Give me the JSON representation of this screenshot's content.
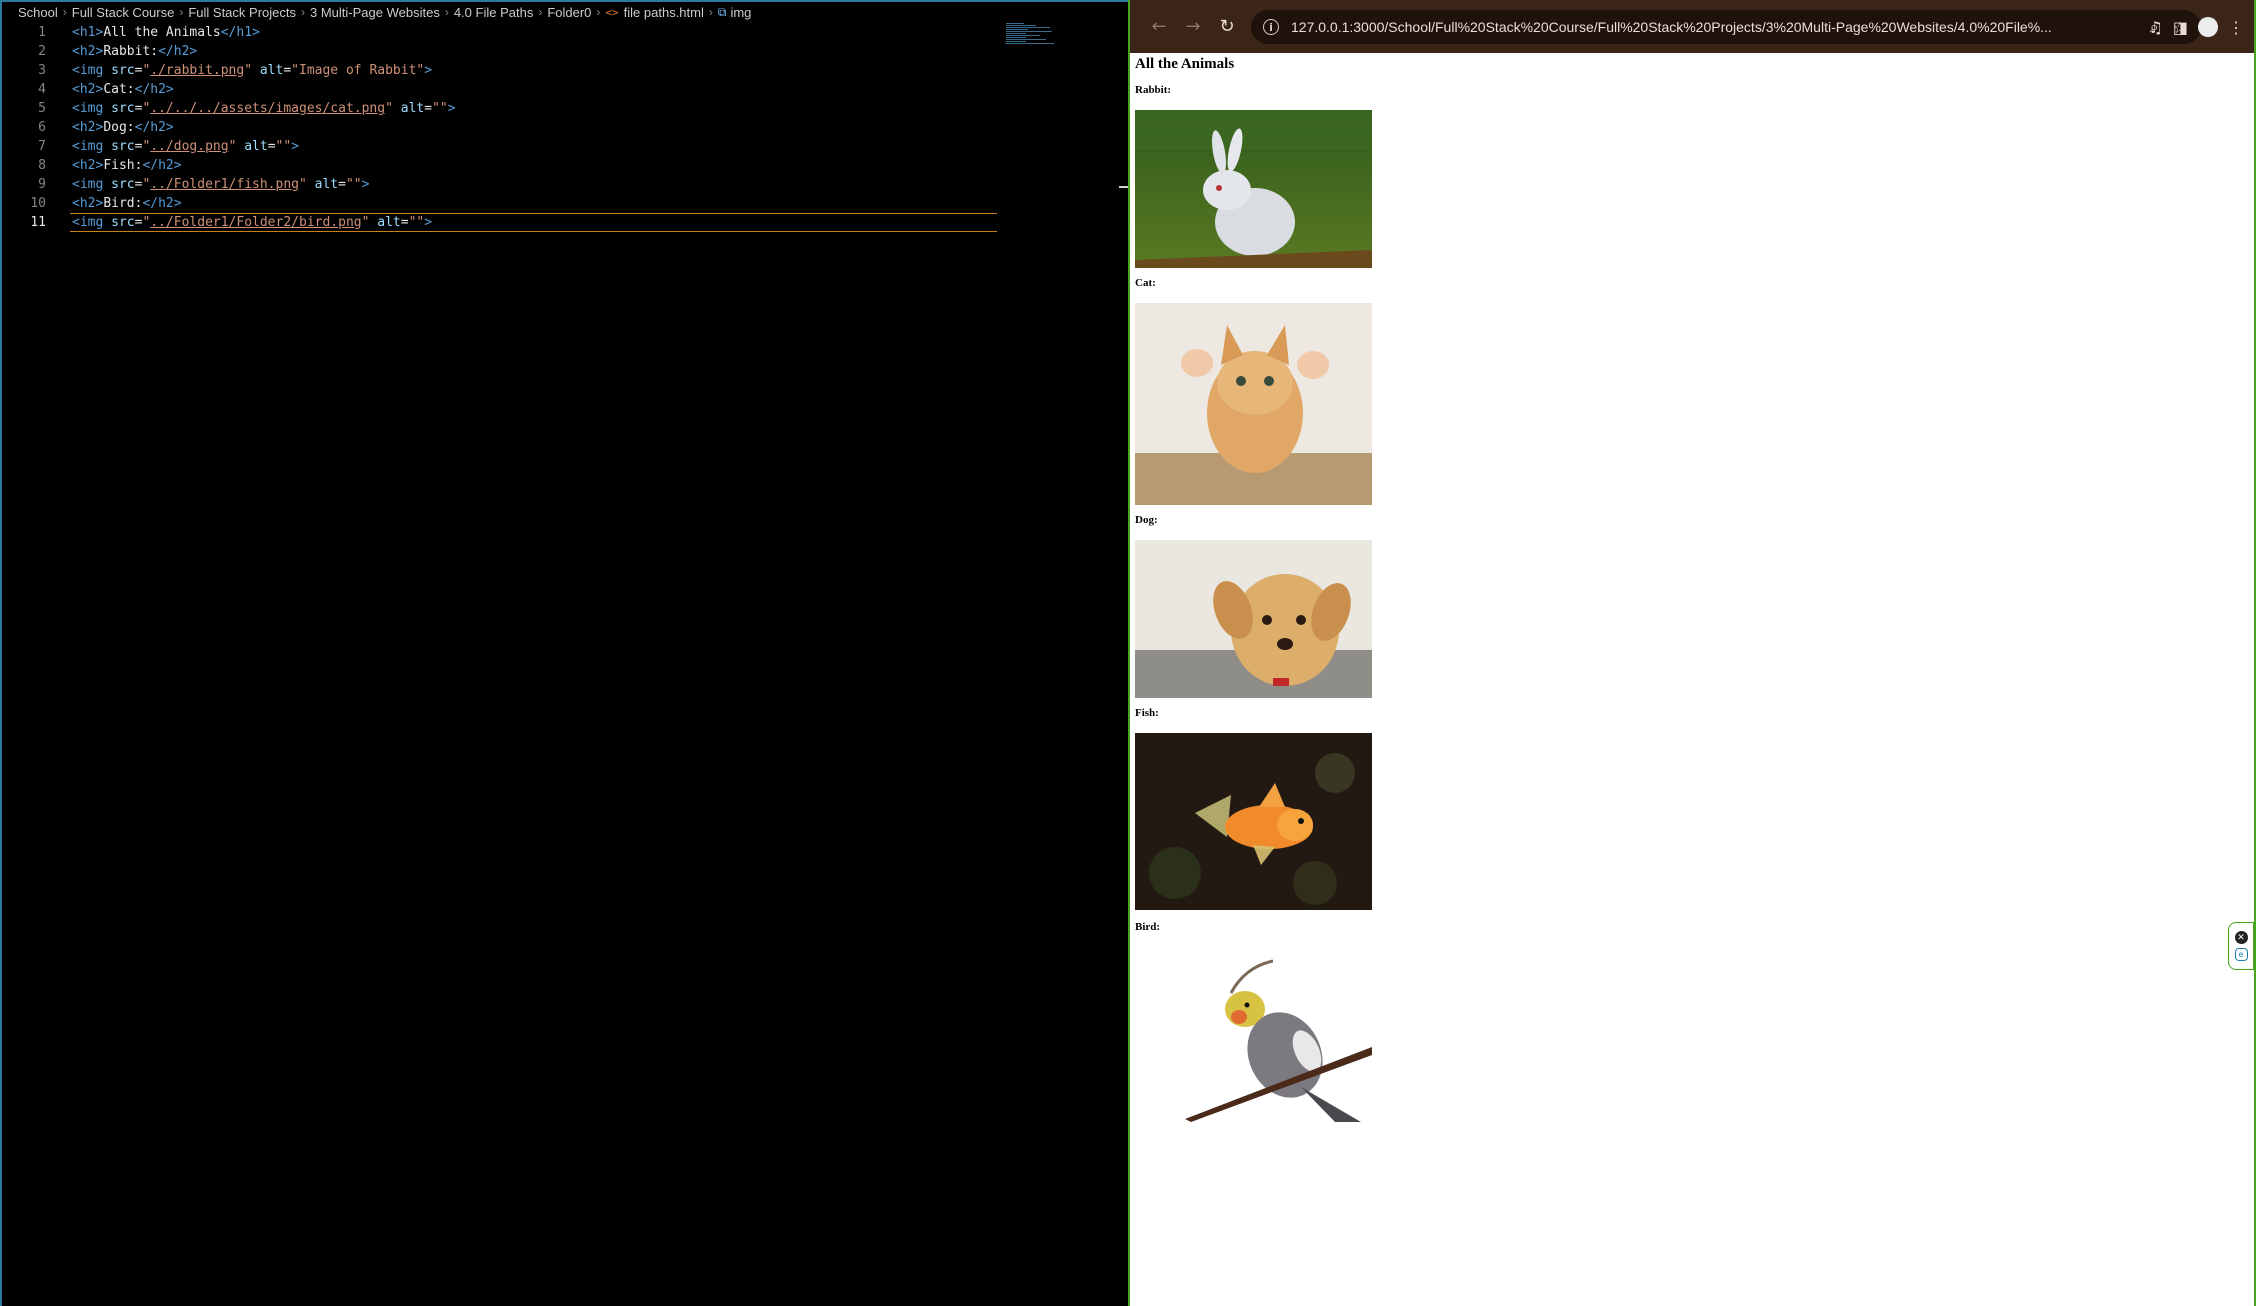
{
  "editor": {
    "breadcrumb": [
      "School",
      "Full Stack Course",
      "Full Stack Projects",
      "3 Multi-Page Websites",
      "4.0 File Paths",
      "Folder0",
      "file paths.html",
      "img"
    ],
    "active_line": 11,
    "lines": [
      {
        "num": "1",
        "parts": [
          [
            "t",
            "<h1>"
          ],
          [
            "tx",
            "All the Animals"
          ],
          [
            "t",
            "</h1>"
          ]
        ]
      },
      {
        "num": "2",
        "parts": [
          [
            "t",
            "<h2>"
          ],
          [
            "tx",
            "Rabbit:"
          ],
          [
            "t",
            "</h2>"
          ]
        ]
      },
      {
        "num": "3",
        "parts": [
          [
            "t",
            "<img "
          ],
          [
            "at",
            "src"
          ],
          [
            "tx",
            "="
          ],
          [
            "st",
            "\""
          ],
          [
            "stp",
            "./rabbit.png"
          ],
          [
            "st",
            "\""
          ],
          [
            "tx",
            " "
          ],
          [
            "at",
            "alt"
          ],
          [
            "tx",
            "="
          ],
          [
            "st",
            "\"Image of Rabbit\""
          ],
          [
            "t",
            ">"
          ]
        ]
      },
      {
        "num": "4",
        "parts": [
          [
            "t",
            "<h2>"
          ],
          [
            "tx",
            "Cat:"
          ],
          [
            "t",
            "</h2>"
          ]
        ]
      },
      {
        "num": "5",
        "parts": [
          [
            "t",
            "<img "
          ],
          [
            "at",
            "src"
          ],
          [
            "tx",
            "="
          ],
          [
            "st",
            "\""
          ],
          [
            "stp",
            "../../../assets/images/cat.png"
          ],
          [
            "st",
            "\""
          ],
          [
            "tx",
            " "
          ],
          [
            "at",
            "alt"
          ],
          [
            "tx",
            "="
          ],
          [
            "st",
            "\"\""
          ],
          [
            "t",
            ">"
          ]
        ]
      },
      {
        "num": "6",
        "parts": [
          [
            "t",
            "<h2>"
          ],
          [
            "tx",
            "Dog:"
          ],
          [
            "t",
            "</h2>"
          ]
        ]
      },
      {
        "num": "7",
        "parts": [
          [
            "t",
            "<img "
          ],
          [
            "at",
            "src"
          ],
          [
            "tx",
            "="
          ],
          [
            "st",
            "\""
          ],
          [
            "stp",
            "../dog.png"
          ],
          [
            "st",
            "\""
          ],
          [
            "tx",
            " "
          ],
          [
            "at",
            "alt"
          ],
          [
            "tx",
            "="
          ],
          [
            "st",
            "\"\""
          ],
          [
            "t",
            ">"
          ]
        ]
      },
      {
        "num": "8",
        "parts": [
          [
            "t",
            "<h2>"
          ],
          [
            "tx",
            "Fish:"
          ],
          [
            "t",
            "</h2>"
          ]
        ]
      },
      {
        "num": "9",
        "parts": [
          [
            "t",
            "<img "
          ],
          [
            "at",
            "src"
          ],
          [
            "tx",
            "="
          ],
          [
            "st",
            "\""
          ],
          [
            "stp",
            "../Folder1/fish.png"
          ],
          [
            "st",
            "\""
          ],
          [
            "tx",
            " "
          ],
          [
            "at",
            "alt"
          ],
          [
            "tx",
            "="
          ],
          [
            "st",
            "\"\""
          ],
          [
            "t",
            ">"
          ]
        ]
      },
      {
        "num": "10",
        "parts": [
          [
            "t",
            "<h2>"
          ],
          [
            "tx",
            "Bird:"
          ],
          [
            "t",
            "</h2>"
          ]
        ]
      },
      {
        "num": "11",
        "parts": [
          [
            "t",
            "<img "
          ],
          [
            "at",
            "src"
          ],
          [
            "tx",
            "="
          ],
          [
            "st",
            "\""
          ],
          [
            "stp",
            "../Folder1/Folder2/bird.png"
          ],
          [
            "st",
            "\""
          ],
          [
            "tx",
            " "
          ],
          [
            "at",
            "alt"
          ],
          [
            "tx",
            "="
          ],
          [
            "st",
            "\"\""
          ],
          [
            "t",
            ">"
          ]
        ]
      }
    ]
  },
  "browser": {
    "url": "127.0.0.1:3000/School/Full%20Stack%20Course/Full%20Stack%20Projects/3%20Multi-Page%20Websites/4.0%20File%...",
    "toolbar_icons": [
      "back-icon",
      "forward-icon",
      "reload-icon",
      "info-icon",
      "zoom-icon",
      "bookmark-star-icon",
      "media-controls-icon",
      "side-panel-icon",
      "profile-avatar",
      "menu-icon"
    ],
    "page": {
      "title": "All the Animals",
      "sections": [
        {
          "heading": "Rabbit:",
          "image_alt": "Image of Rabbit",
          "image": "rabbit-photo"
        },
        {
          "heading": "Cat:",
          "image_alt": "",
          "image": "cat-photo"
        },
        {
          "heading": "Dog:",
          "image_alt": "",
          "image": "dog-photo"
        },
        {
          "heading": "Fish:",
          "image_alt": "",
          "image": "fish-photo"
        },
        {
          "heading": "Bird:",
          "image_alt": "",
          "image": "bird-photo"
        }
      ]
    }
  },
  "colors": {
    "editor_bg": "#000000",
    "tag": "#569cd6",
    "attribute": "#9cdcfe",
    "string": "#ce9178",
    "browser_toolbar": "#3b2518",
    "window_border": "#47a51c"
  }
}
